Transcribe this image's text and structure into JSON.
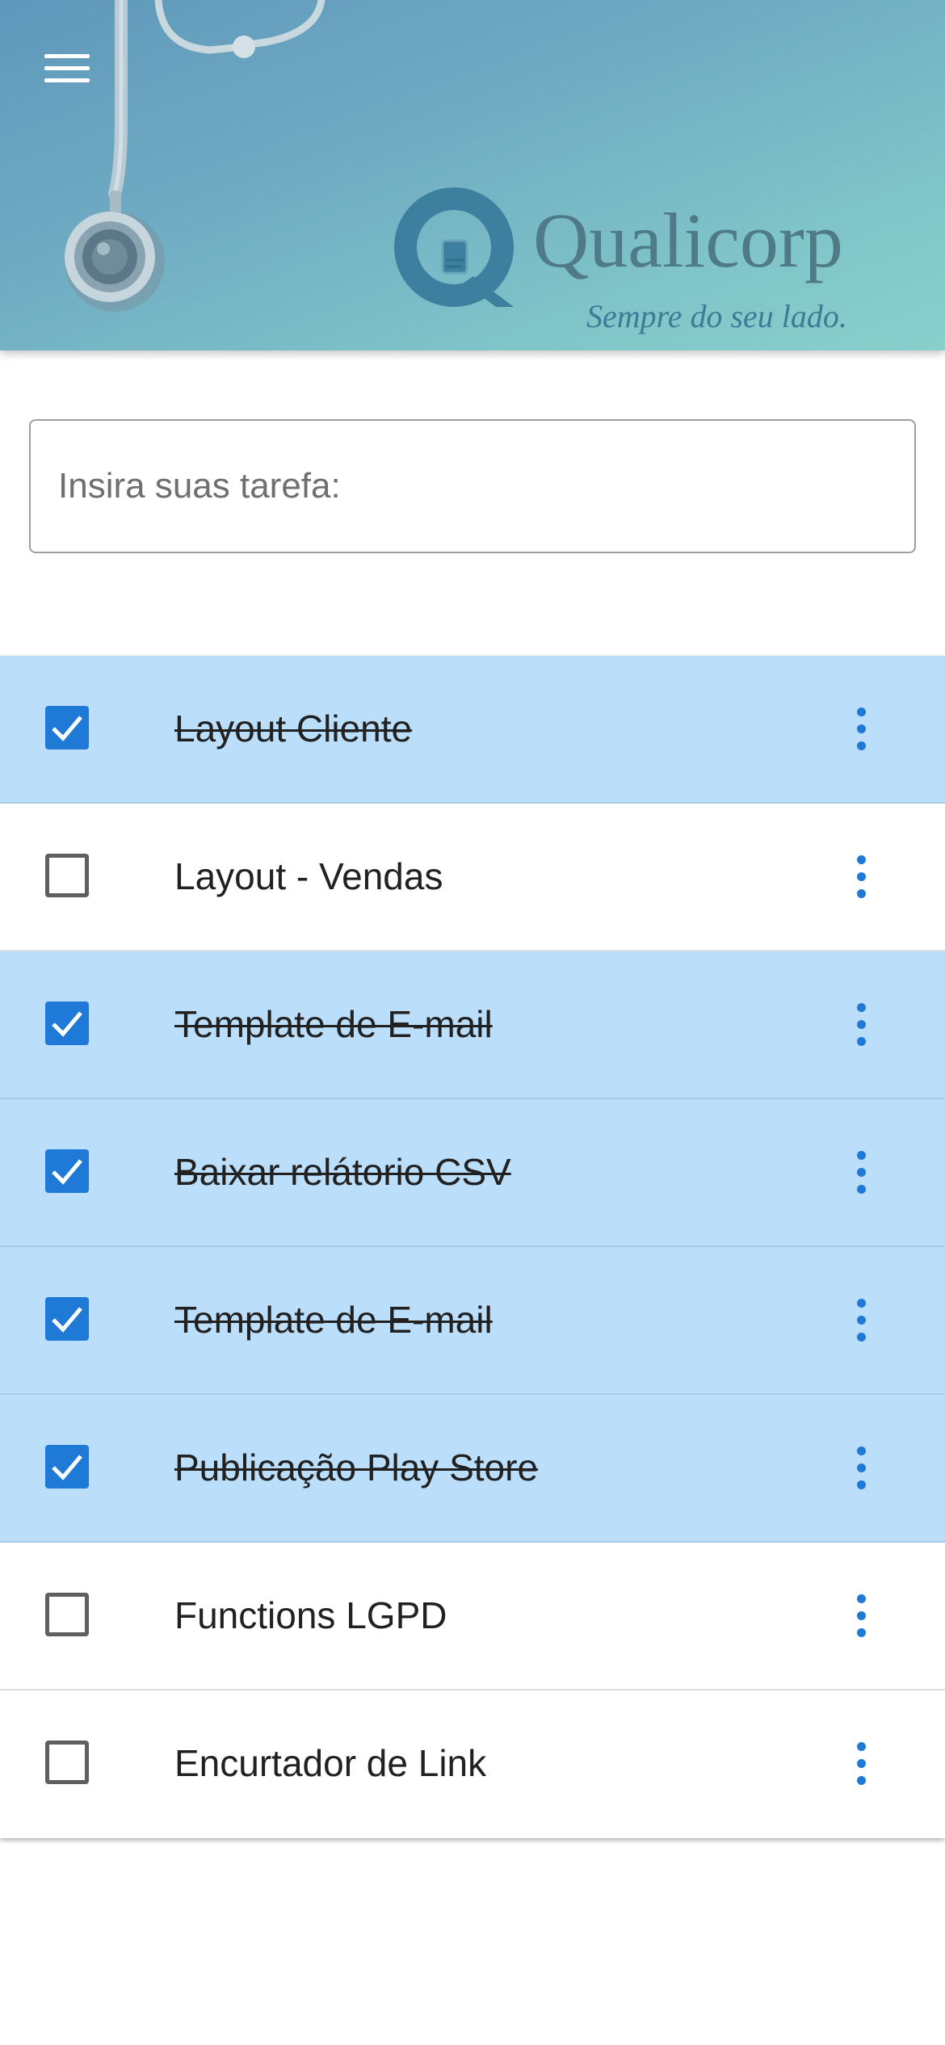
{
  "header": {
    "menu_icon": "hamburger-menu-icon",
    "logo": {
      "name": "Qualicorp",
      "tagline": "Sempre do seu lado."
    }
  },
  "task_input": {
    "placeholder": "Insira suas tarefa:",
    "value": ""
  },
  "tasks": [
    {
      "label": "Layout Cliente",
      "completed": true
    },
    {
      "label": "Layout - Vendas",
      "completed": false
    },
    {
      "label": "Template de E-mail",
      "completed": true
    },
    {
      "label": "Baixar relátorio CSV",
      "completed": true
    },
    {
      "label": "Template de E-mail",
      "completed": true
    },
    {
      "label": "Publicação Play Store",
      "completed": true
    },
    {
      "label": "Functions LGPD",
      "completed": false
    },
    {
      "label": "Encurtador de Link",
      "completed": false
    }
  ],
  "icons": {
    "checkbox_checked": "check-icon",
    "row_menu": "more-vertical-icon"
  },
  "colors": {
    "accent": "#1e7ad6",
    "completed_row_bg": "#bbdefa",
    "header_gradient_start": "#5f98bb",
    "header_gradient_end": "#89d0cc"
  }
}
